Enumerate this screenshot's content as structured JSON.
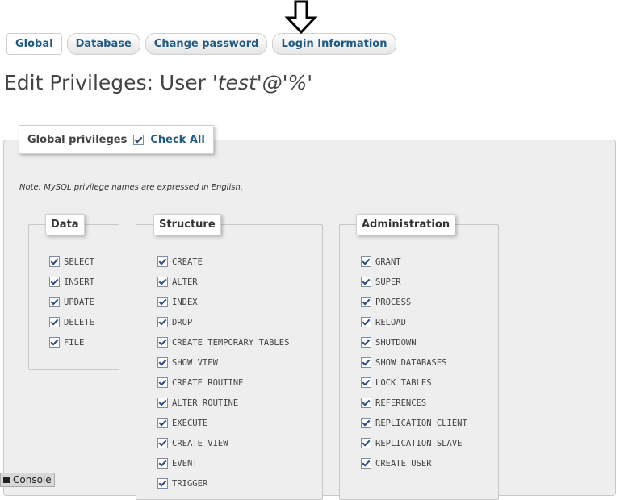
{
  "tabs": [
    "Global",
    "Database",
    "Change password",
    "Login Information"
  ],
  "title": {
    "prefix": "Edit Privileges: User ",
    "user": "'test'@'%'"
  },
  "global": {
    "legend": "Global privileges",
    "check_all": "Check All"
  },
  "note": "Note: MySQL privilege names are expressed in English.",
  "groups": {
    "data": {
      "legend": "Data",
      "items": [
        "SELECT",
        "INSERT",
        "UPDATE",
        "DELETE",
        "FILE"
      ]
    },
    "structure": {
      "legend": "Structure",
      "items": [
        "CREATE",
        "ALTER",
        "INDEX",
        "DROP",
        "CREATE TEMPORARY TABLES",
        "SHOW VIEW",
        "CREATE ROUTINE",
        "ALTER ROUTINE",
        "EXECUTE",
        "CREATE VIEW",
        "EVENT",
        "TRIGGER"
      ]
    },
    "administration": {
      "legend": "Administration",
      "items": [
        "GRANT",
        "SUPER",
        "PROCESS",
        "RELOAD",
        "SHUTDOWN",
        "SHOW DATABASES",
        "LOCK TABLES",
        "REFERENCES",
        "REPLICATION CLIENT",
        "REPLICATION SLAVE",
        "CREATE USER"
      ]
    }
  },
  "console": {
    "label": "Console"
  },
  "colors": {
    "link": "#235a81",
    "panel": "#eeeeee"
  }
}
